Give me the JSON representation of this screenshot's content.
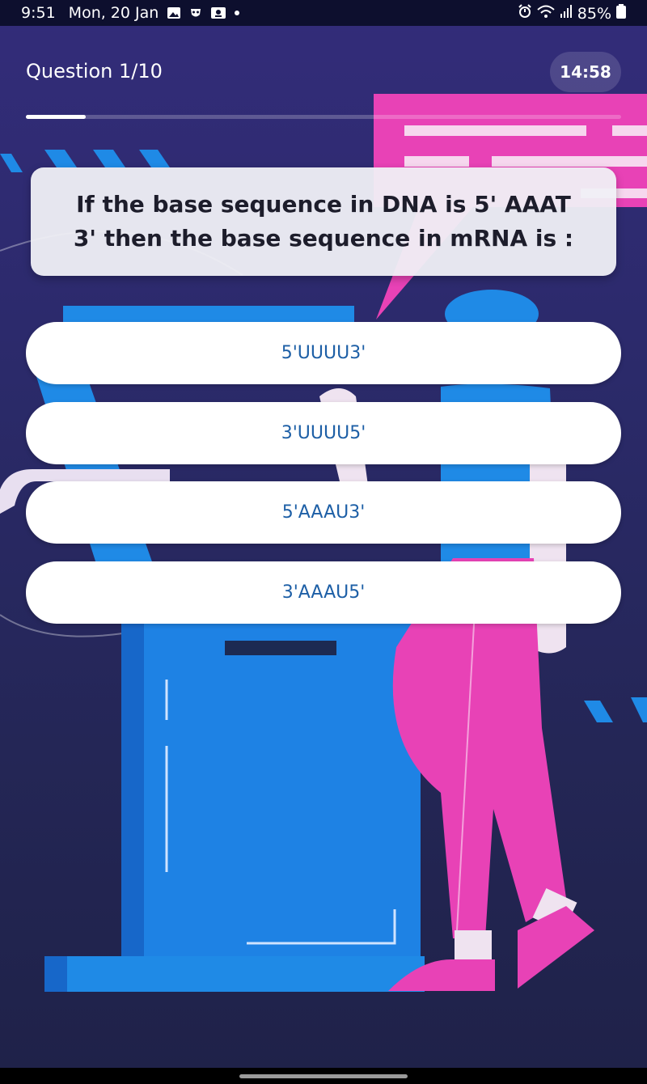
{
  "status_bar": {
    "time": "9:51",
    "date": "Mon, 20 Jan",
    "battery": "85%",
    "icons": [
      "gallery-icon",
      "mask-icon",
      "notification-icon",
      "alarm-icon",
      "wifi-icon",
      "signal-icon",
      "battery-icon"
    ]
  },
  "quiz": {
    "counter": "Question 1/10",
    "timer": "14:58",
    "progress": 0.1,
    "question": "If the base sequence in DNA is 5' AAAT 3' then the base sequence in mRNA is :",
    "options": [
      "5'UUUU3'",
      "3'UUUU5'",
      "5'AAAU3'",
      "3'AAAU5'"
    ]
  },
  "colors": {
    "background": "#2b2a6a",
    "accent_pink": "#e842b6",
    "accent_blue": "#1f8ae6",
    "option_text": "#1d5fa6"
  }
}
